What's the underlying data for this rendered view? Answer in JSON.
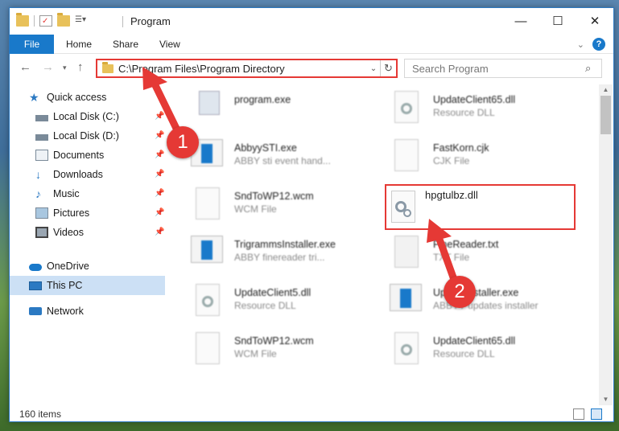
{
  "window": {
    "title": "Program",
    "controls": {
      "minimize": "—",
      "maximize": "☐",
      "close": "✕"
    }
  },
  "ribbon": {
    "tabs": [
      "File",
      "Home",
      "Share",
      "View"
    ],
    "help": "?"
  },
  "navbar": {
    "address": "C:\\Program Files\\Program Directory",
    "search_placeholder": "Search Program"
  },
  "sidebar": {
    "items": [
      {
        "label": "Quick access",
        "icon": "star-icon"
      },
      {
        "label": "Local Disk (C:)",
        "icon": "drive-icon",
        "pinned": true
      },
      {
        "label": "Local Disk (D:)",
        "icon": "drive-icon",
        "pinned": true
      },
      {
        "label": "Documents",
        "icon": "documents-icon",
        "pinned": true
      },
      {
        "label": "Downloads",
        "icon": "download-icon",
        "pinned": true
      },
      {
        "label": "Music",
        "icon": "music-icon",
        "pinned": true
      },
      {
        "label": "Pictures",
        "icon": "pictures-icon",
        "pinned": true
      },
      {
        "label": "Videos",
        "icon": "videos-icon",
        "pinned": true
      },
      {
        "label": "OneDrive",
        "icon": "cloud-icon"
      },
      {
        "label": "This PC",
        "icon": "computer-icon",
        "selected": true
      },
      {
        "label": "Network",
        "icon": "network-icon"
      }
    ]
  },
  "files": {
    "left": [
      {
        "name": "program.exe",
        "type": ""
      },
      {
        "name": "AbbyySTI.exe",
        "type": "ABBY sti event hand..."
      },
      {
        "name": "SndToWP12.wcm",
        "type": "WCM File"
      },
      {
        "name": "TrigrammsInstaller.exe",
        "type": "ABBY finereader tri..."
      },
      {
        "name": "UpdateClient5.dll",
        "type": "Resource DLL"
      },
      {
        "name": "SndToWP12.wcm",
        "type": "WCM File"
      }
    ],
    "right": [
      {
        "name": "UpdateClient65.dll",
        "type": "Resource DLL"
      },
      {
        "name": "FastKorn.cjk",
        "type": "CJK File"
      },
      {
        "name": "hpgtulbz.dll",
        "type": ""
      },
      {
        "name": "FineReader.txt",
        "type": "TXT File"
      },
      {
        "name": "Updateinstaller.exe",
        "type": "ABBYY updates installer"
      },
      {
        "name": "UpdateClient65.dll",
        "type": "Resource DLL"
      }
    ]
  },
  "status": {
    "count": "160 items"
  },
  "annotations": {
    "step1": "1",
    "step2": "2"
  },
  "colors": {
    "accent": "#1979ca",
    "highlight": "#e53935"
  }
}
